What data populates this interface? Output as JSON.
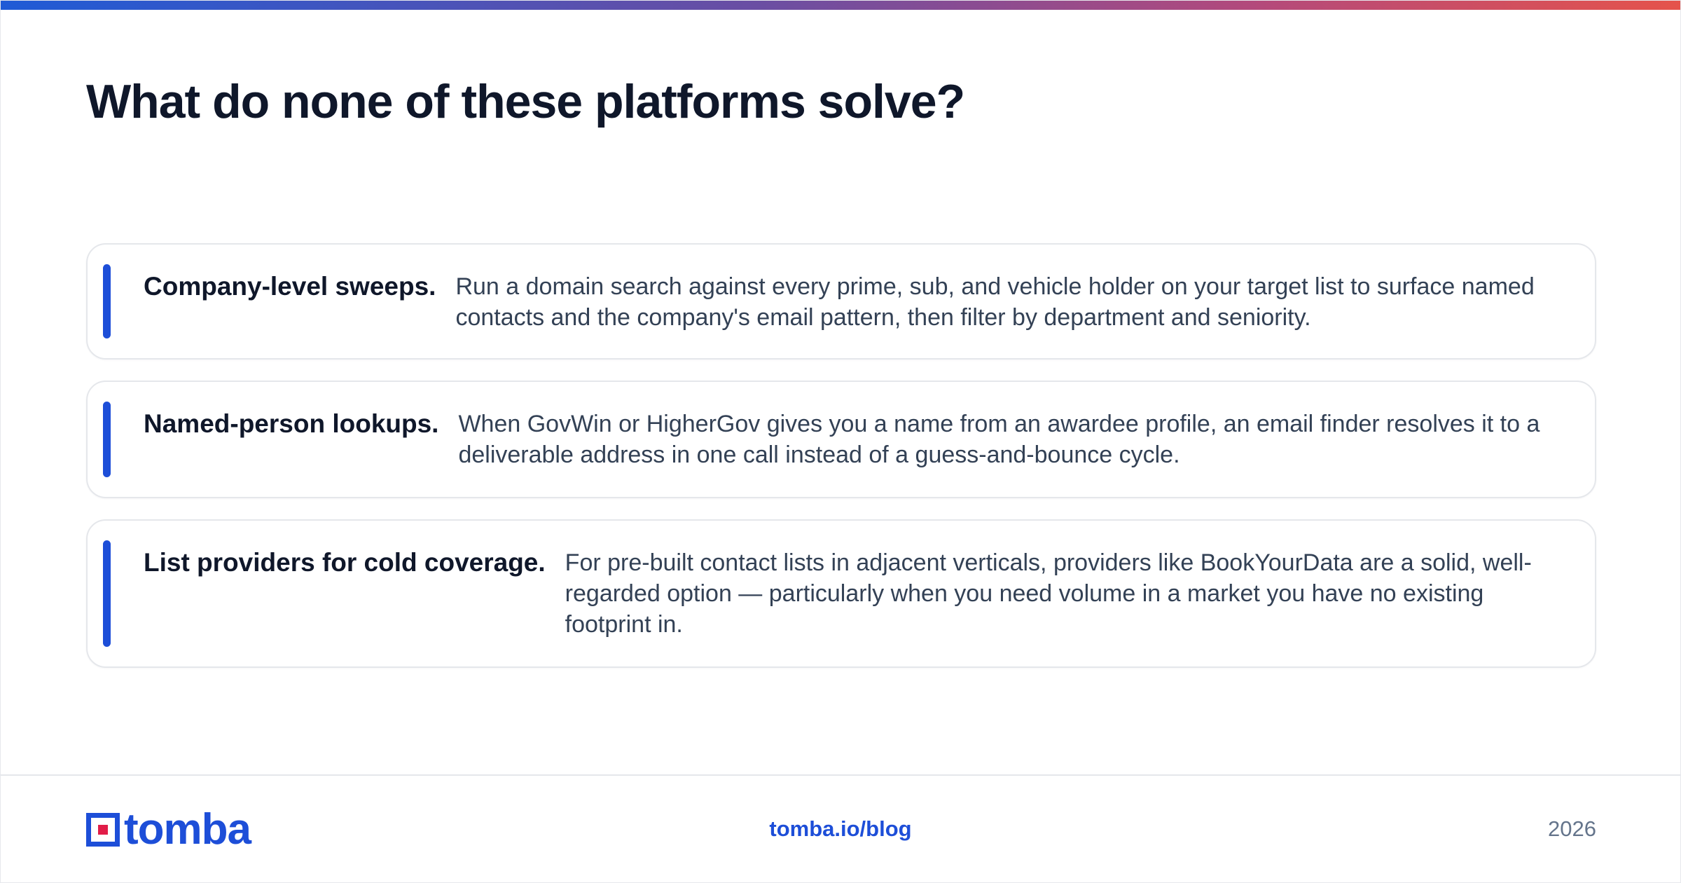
{
  "slide": {
    "title": "What do none of these platforms solve?",
    "cards": [
      {
        "heading": "Company-level sweeps.",
        "body": "Run a domain search against every prime, sub, and vehicle holder on your target list to surface named contacts and the company's email pattern, then filter by department and seniority."
      },
      {
        "heading": "Named-person lookups.",
        "body": "When GovWin or HigherGov gives you a name from an awardee profile, an email finder resolves it to a deliverable address in one call instead of a guess-and-bounce cycle."
      },
      {
        "heading": "List providers for cold coverage.",
        "body": "For pre-built contact lists in adjacent verticals, providers like BookYourData are a solid, well-regarded option — particularly when you need volume in a market you have no existing footprint in."
      }
    ]
  },
  "footer": {
    "logo_text": "tomba",
    "url": "tomba.io/blog",
    "year": "2026"
  },
  "colors": {
    "accent": "#1d4ed8",
    "title": "#0f172a",
    "body": "#334155",
    "logo_square": "#e11d48"
  }
}
